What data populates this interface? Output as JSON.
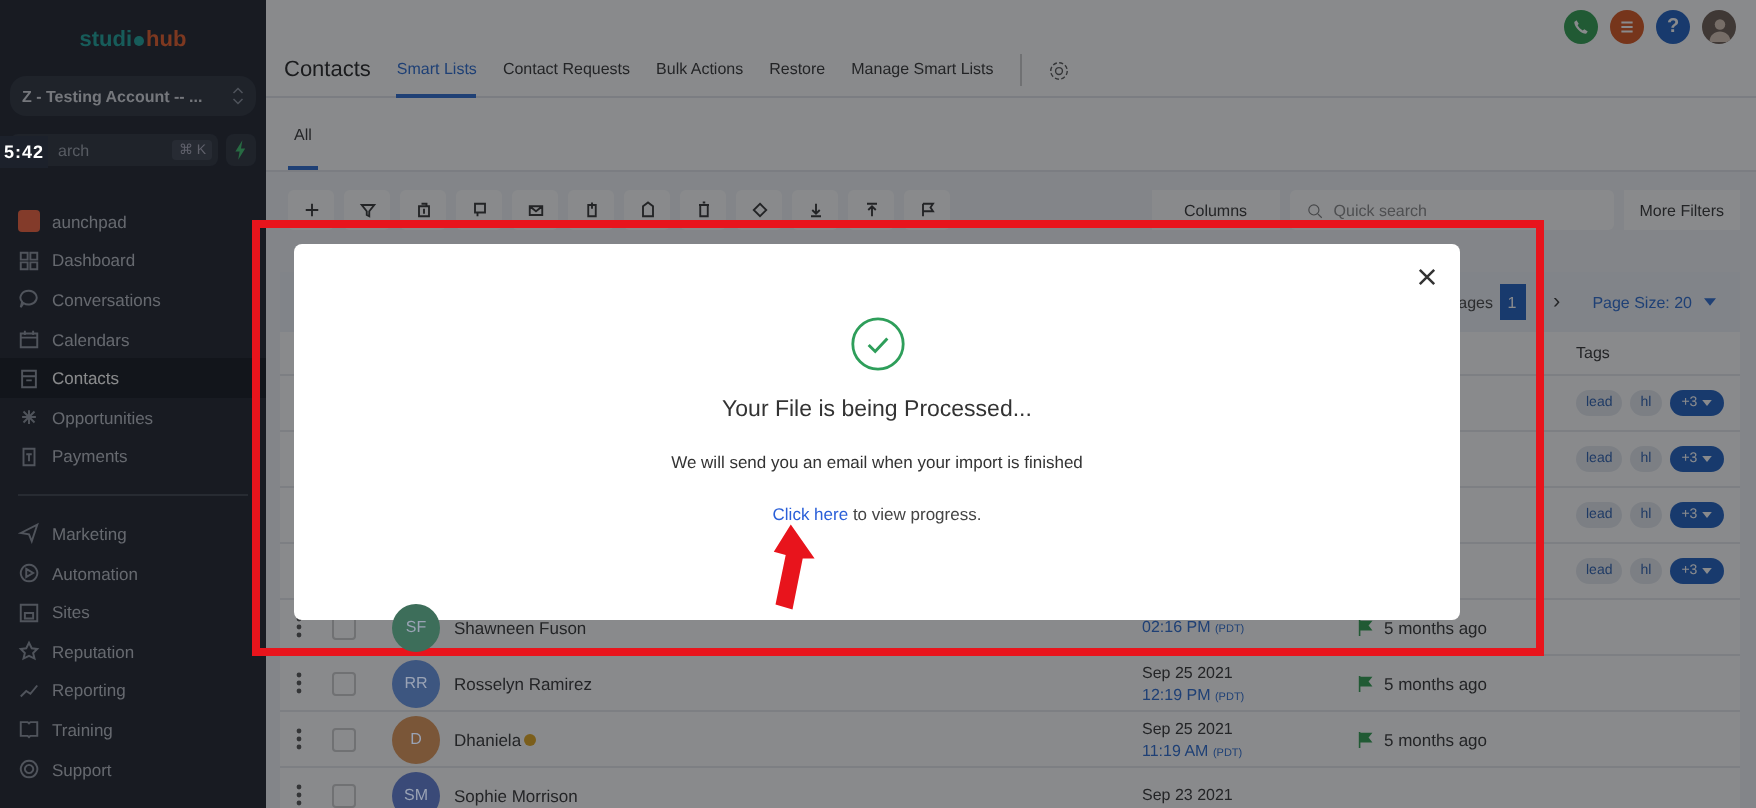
{
  "video_timestamp": "5:42",
  "sidebar": {
    "logo": {
      "first": "studi",
      "second": "hub"
    },
    "account": "Z - Testing Account -- ...",
    "search": {
      "placeholder": "arch",
      "shortcut": "⌘ K"
    },
    "sections": [
      {
        "items": [
          {
            "label": "aunchpad",
            "selected": false
          },
          {
            "label": "Dashboard",
            "selected": false
          },
          {
            "label": "Conversations",
            "selected": false
          },
          {
            "label": "Calendars",
            "selected": false
          },
          {
            "label": "Contacts",
            "selected": true
          },
          {
            "label": "Opportunities",
            "selected": false
          },
          {
            "label": "Payments",
            "selected": false
          }
        ]
      },
      {
        "items": [
          {
            "label": "Marketing",
            "selected": false
          },
          {
            "label": "Automation",
            "selected": false
          },
          {
            "label": "Sites",
            "selected": false
          },
          {
            "label": "Reputation",
            "selected": false
          },
          {
            "label": "Reporting",
            "selected": false
          },
          {
            "label": "Training",
            "selected": false
          },
          {
            "label": "Support",
            "selected": false
          }
        ]
      }
    ]
  },
  "header": {
    "help": "?",
    "title": "Contacts",
    "tabs": [
      {
        "label": "Smart Lists",
        "selected": true
      },
      {
        "label": "Contact Requests",
        "selected": false
      },
      {
        "label": "Bulk Actions",
        "selected": false
      },
      {
        "label": "Restore",
        "selected": false
      },
      {
        "label": "Manage Smart Lists",
        "selected": false
      }
    ]
  },
  "subtabs": [
    {
      "label": "All",
      "selected": true
    }
  ],
  "toolbar": {
    "columns": "Columns",
    "search_placeholder": "Quick search",
    "more_filters": "More Filters"
  },
  "pagination": {
    "label": "ages",
    "current": "1",
    "next": "›",
    "page_size": "Page Size: 20"
  },
  "table": {
    "tags_header": "Tags",
    "rows": [
      {
        "kind": "tags",
        "tags": [
          "lead",
          "hl"
        ],
        "more": "+3"
      },
      {
        "kind": "tags",
        "tags": [
          "lead",
          "hl"
        ],
        "more": "+3"
      },
      {
        "kind": "tags",
        "tags": [
          "lead",
          "hl"
        ],
        "more": "+3"
      },
      {
        "kind": "tags",
        "tags": [
          "lead",
          "hl"
        ],
        "more": "+3"
      },
      {
        "kind": "contact",
        "checked": false,
        "initials": "SF",
        "color": "#3d6e5a",
        "name": "Shawneen Fuson",
        "emoji": false,
        "time": "02:16 PM",
        "tz": "(PDT)",
        "activity": "5 months ago"
      },
      {
        "kind": "contact",
        "checked": false,
        "initials": "RR",
        "color": "#3d5680",
        "name": "Rosselyn Ramirez",
        "emoji": false,
        "date": "Sep 25 2021",
        "time": "12:19 PM",
        "tz": "(PDT)",
        "activity": "5 months ago"
      },
      {
        "kind": "contact",
        "checked": false,
        "initials": "D",
        "color": "#7a5638",
        "name": "Dhaniela",
        "emoji": true,
        "date": "Sep 25 2021",
        "time": "11:19 AM",
        "tz": "(PDT)",
        "activity": "5 months ago"
      },
      {
        "kind": "contact",
        "checked": false,
        "initials": "SM",
        "color": "#3a4a78",
        "name": "Sophie Morrison",
        "emoji": false,
        "date": "Sep 23 2021"
      }
    ]
  },
  "modal": {
    "title": "Your File is being Processed...",
    "message": "We will send you an email when your import is finished",
    "link": "Click here",
    "link_rest": " to view progress."
  }
}
